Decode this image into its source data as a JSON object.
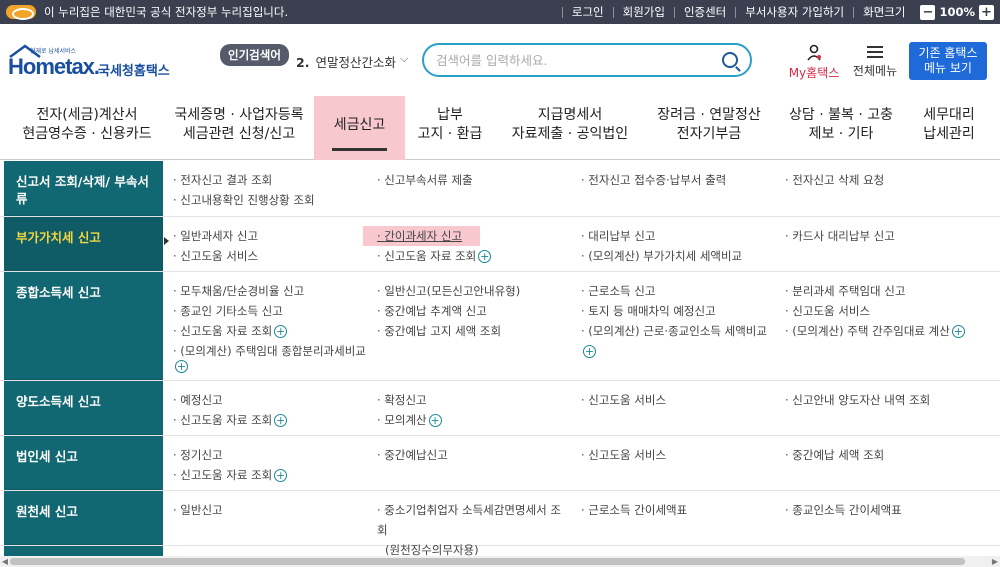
{
  "gov_bar": {
    "notice": "이 누리집은 대한민국 공식 전자정부 누리집입니다.",
    "links": [
      "로그인",
      "회원가입",
      "인증센터",
      "부서사용자 가입하기",
      "화면크기"
    ],
    "zoom": "100%",
    "minus": "−",
    "plus": "+"
  },
  "header": {
    "logo_tag": "현재로 납세서비스",
    "logo_main": "Hometax.",
    "logo_sub": "국세청홈택스",
    "popular_badge": "인기검색어",
    "popular_num": "2.",
    "popular_text": "연말정산간소화",
    "search_placeholder": "검색어를 입력하세요.",
    "myhome": "My홈택스",
    "allmenu": "전체메뉴",
    "oldmenu_line1": "기존 홈택스",
    "oldmenu_line2": "메뉴 보기"
  },
  "gnb": [
    {
      "l1": "전자(세금)계산서",
      "l2": "현금영수증 · 신용카드"
    },
    {
      "l1": "국세증명 · 사업자등록",
      "l2": "세금관련 신청/신고"
    },
    {
      "l1": "세금신고",
      "l2": ""
    },
    {
      "l1": "납부",
      "l2": "고지 · 환급"
    },
    {
      "l1": "지급명세서",
      "l2": "자료제출 · 공익법인"
    },
    {
      "l1": "장려금 · 연말정산",
      "l2": "전자기부금"
    },
    {
      "l1": "상담 · 불복 · 고충",
      "l2": "제보 · 기타"
    },
    {
      "l1": "세무대리",
      "l2": "납세관리"
    }
  ],
  "rows": [
    {
      "title": "신고서 조회/삭제/ 부속서류",
      "cols": [
        [
          "· 전자신고 결과 조회",
          "· 신고내용확인 진행상황 조회"
        ],
        [
          "· 신고부속서류 제출"
        ],
        [
          "· 전자신고 접수증·납부서 출력"
        ],
        [
          "· 전자신고 삭제 요청"
        ]
      ]
    },
    {
      "title": "부가가치세 신고",
      "cols": [
        [
          "· 일반과세자 신고",
          "· 신고도움 서비스"
        ],
        [
          "· 간이과세자 신고",
          "· 신고도움 자료 조회"
        ],
        [
          "· 대리납부 신고",
          "· (모의계산) 부가가치세 세액비교"
        ],
        [
          "· 카드사 대리납부 신고"
        ]
      ]
    },
    {
      "title": "종합소득세 신고",
      "cols": [
        [
          "· 모두채움/단순경비율 신고",
          "· 종교인 기타소득 신고",
          "· 신고도움 자료 조회",
          "· (모의계산) 주택임대 종합분리과세비교"
        ],
        [
          "· 일반신고(모든신고안내유형)",
          "· 중간예납 추계액 신고",
          "· 중간예납 고지 세액 조회"
        ],
        [
          "· 근로소득 신고",
          "· 토지 등 매매차익 예정신고",
          "· (모의계산) 근로·종교인소득 세액비교"
        ],
        [
          "· 분리과세 주택임대 신고",
          "· 신고도움 서비스",
          "· (모의계산) 주택 간주임대료 계산"
        ]
      ]
    },
    {
      "title": "양도소득세 신고",
      "cols": [
        [
          "· 예정신고",
          "· 신고도움 자료 조회"
        ],
        [
          "· 확정신고",
          "· 모의계산"
        ],
        [
          "· 신고도움 서비스"
        ],
        [
          "· 신고안내 양도자산 내역 조회"
        ]
      ]
    },
    {
      "title": "법인세 신고",
      "cols": [
        [
          "· 정기신고",
          "· 신고도움 자료 조회"
        ],
        [
          "· 중간예납신고"
        ],
        [
          "· 신고도움 서비스"
        ],
        [
          "· 중간예납 세액 조회"
        ]
      ]
    },
    {
      "title": "원천세 신고",
      "cols": [
        [
          "· 일반신고"
        ],
        [
          "· 중소기업취업자 소득세감면명세서 조회",
          "(원천징수의무자용)"
        ],
        [
          "· 근로소득 간이세액표"
        ],
        [
          "· 종교인소득 간이세액표"
        ]
      ]
    }
  ]
}
